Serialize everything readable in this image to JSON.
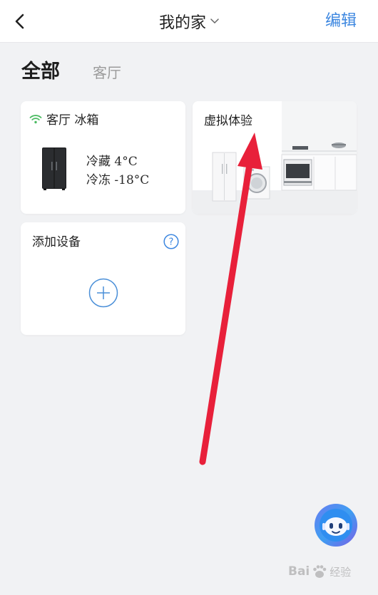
{
  "header": {
    "title": "我的家",
    "edit_label": "编辑"
  },
  "tabs": [
    {
      "label": "全部",
      "active": true
    },
    {
      "label": "客厅",
      "active": false
    }
  ],
  "devices": {
    "fridge": {
      "name": "客厅 冰箱",
      "online_icon": "wifi-icon",
      "fridge_temp": "冷藏 4°C",
      "freezer_temp": "冷冻 -18°C"
    },
    "virtual": {
      "label": "虚拟体验"
    },
    "add": {
      "label": "添加设备",
      "help_icon": "question-icon",
      "plus_icon": "plus-icon"
    }
  },
  "assistant": {
    "icon": "robot-assistant-icon"
  },
  "watermark": {
    "text": "Bai",
    "sub": "经验"
  },
  "colors": {
    "accent": "#3d87e0",
    "wifi": "#4cbb63",
    "background": "#f1f2f4",
    "annotation_arrow": "#e8203a"
  }
}
